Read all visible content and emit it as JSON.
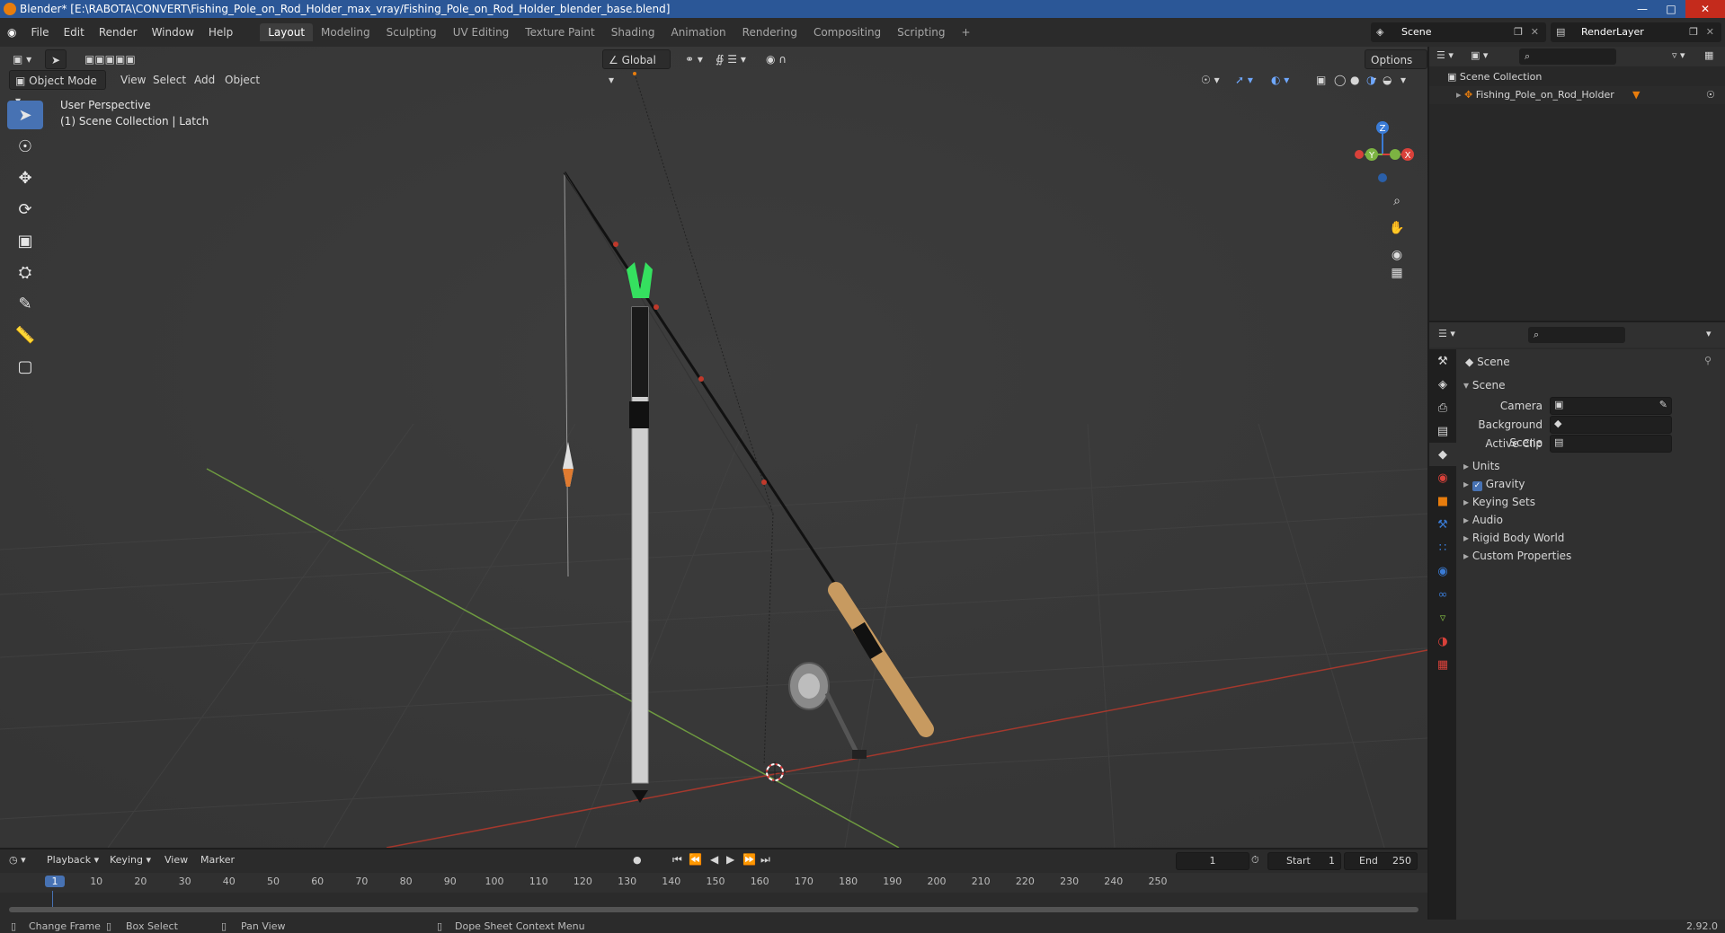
{
  "window": {
    "title": "Blender* [E:\\RABOTA\\CONVERT\\Fishing_Pole_on_Rod_Holder_max_vray/Fishing_Pole_on_Rod_Holder_blender_base.blend]"
  },
  "menu": [
    "File",
    "Edit",
    "Render",
    "Window",
    "Help"
  ],
  "workspaces": [
    "Layout",
    "Modeling",
    "Sculpting",
    "UV Editing",
    "Texture Paint",
    "Shading",
    "Animation",
    "Rendering",
    "Compositing",
    "Scripting"
  ],
  "active_workspace": "Layout",
  "scene_name": "Scene",
  "view_layer": "RenderLayer",
  "viewport": {
    "mode": "Object Mode",
    "menus": [
      "View",
      "Select",
      "Add",
      "Object"
    ],
    "transform_orientation": "Global",
    "options_label": "Options",
    "info_line1": "User Perspective",
    "info_line2": "(1) Scene Collection | Latch",
    "gizmo": {
      "z": "Z",
      "y": "Y",
      "x": "X"
    }
  },
  "outliner": {
    "root": "Scene Collection",
    "items": [
      "Fishing_Pole_on_Rod_Holder"
    ]
  },
  "properties": {
    "header": "Scene",
    "section": "Scene",
    "fields": {
      "camera_label": "Camera",
      "bg_scene_label": "Background Scene",
      "active_clip_label": "Active Clip"
    },
    "panels": [
      "Units",
      "Gravity",
      "Keying Sets",
      "Audio",
      "Rigid Body World",
      "Custom Properties"
    ],
    "gravity_checked": true
  },
  "timeline": {
    "menus": [
      "Playback",
      "Keying",
      "View",
      "Marker"
    ],
    "current_frame": "1",
    "start_label": "Start",
    "start": "1",
    "end_label": "End",
    "end": "250",
    "ruler": [
      "1",
      "10",
      "20",
      "30",
      "40",
      "50",
      "60",
      "70",
      "80",
      "90",
      "100",
      "110",
      "120",
      "130",
      "140",
      "150",
      "160",
      "170",
      "180",
      "190",
      "200",
      "210",
      "220",
      "230",
      "240",
      "250"
    ]
  },
  "statusbar": {
    "items": [
      "Change Frame",
      "Box Select",
      "Pan View",
      "Dope Sheet Context Menu"
    ],
    "version": "2.92.0"
  },
  "colors": {
    "accent": "#4772b3",
    "x_axis": "#d9413a",
    "y_axis": "#7cb342",
    "z_axis": "#3a7bd5",
    "bobber_tip": "#35e05f"
  }
}
